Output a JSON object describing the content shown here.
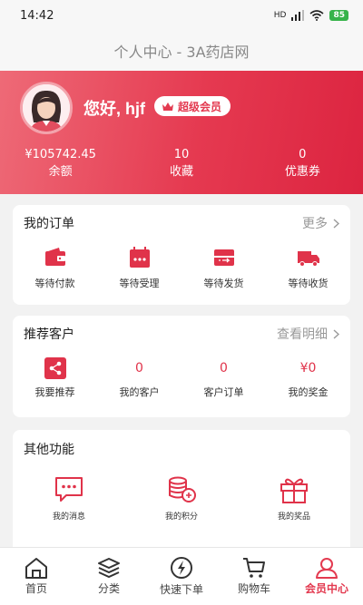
{
  "status_bar": {
    "time": "14:42",
    "network": "HD",
    "battery": "85"
  },
  "header": {
    "title": "个人中心 - 3A药店网"
  },
  "profile": {
    "greeting": "您好, hjf",
    "badge": "超级会员",
    "stats": [
      {
        "value": "¥105742.45",
        "label": "余额"
      },
      {
        "value": "10",
        "label": "收藏"
      },
      {
        "value": "0",
        "label": "优惠券"
      }
    ]
  },
  "orders": {
    "title": "我的订单",
    "more": "更多",
    "items": [
      {
        "label": "等待付款",
        "icon": "wallet-icon"
      },
      {
        "label": "等待受理",
        "icon": "calendar-icon"
      },
      {
        "label": "等待发货",
        "icon": "box-icon"
      },
      {
        "label": "等待收货",
        "icon": "truck-icon"
      }
    ]
  },
  "referral": {
    "title": "推荐客户",
    "more": "查看明细",
    "items": [
      {
        "label": "我要推荐",
        "value": ""
      },
      {
        "label": "我的客户",
        "value": "0"
      },
      {
        "label": "客户订单",
        "value": "0"
      },
      {
        "label": "我的奖金",
        "value": "¥0"
      }
    ]
  },
  "other": {
    "title": "其他功能",
    "items": [
      {
        "label": "我的消息",
        "icon": "message-icon"
      },
      {
        "label": "我的积分",
        "icon": "coins-icon"
      },
      {
        "label": "我的奖品",
        "icon": "gift-icon"
      }
    ]
  },
  "tabbar": {
    "items": [
      {
        "label": "首页",
        "icon": "home-icon"
      },
      {
        "label": "分类",
        "icon": "layers-icon"
      },
      {
        "label": "快速下单",
        "icon": "lightning-icon"
      },
      {
        "label": "购物车",
        "icon": "cart-icon"
      },
      {
        "label": "会员中心",
        "icon": "user-icon"
      }
    ],
    "active_index": 4
  },
  "colors": {
    "brand": "#e33a50",
    "accent_text": "#e0334a"
  }
}
